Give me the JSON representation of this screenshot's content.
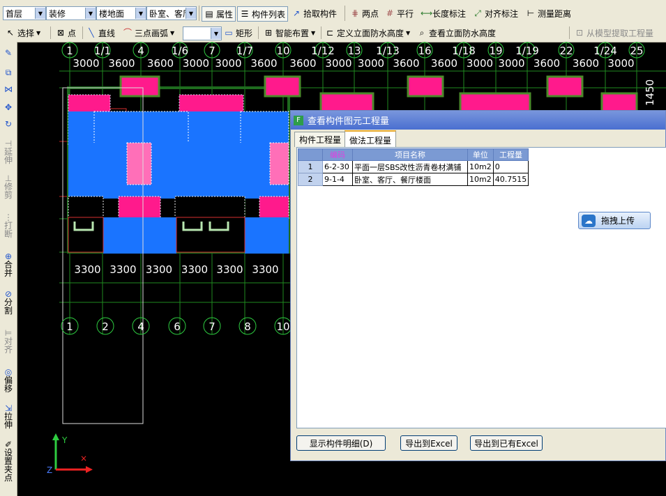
{
  "toolbar1": {
    "floor_combo": "首层",
    "category_combo": "装修",
    "type_combo": "楼地面",
    "name_combo": "卧室、客厅",
    "properties": "属性",
    "component_list": "构件列表",
    "pick_component": "拾取构件",
    "two_points": "两点",
    "parallel": "平行",
    "length_dim": "长度标注",
    "align_dim": "对齐标注",
    "measure_distance": "测量距离"
  },
  "toolbar2": {
    "select": "选择",
    "point": "点",
    "line": "直线",
    "three_point_arc": "三点画弧",
    "blank_combo": "",
    "rectangle": "矩形",
    "smart_layout": "智能布置",
    "define_waterproof": "定义立面防水高度",
    "view_waterproof": "查看立面防水高度",
    "extract_quantity": "从模型提取工程量"
  },
  "left_toolbar": [
    "延伸",
    "修剪",
    "打断",
    "合并",
    "分割",
    "对齐",
    "偏移",
    "拉伸",
    "设置夹点"
  ],
  "canvas": {
    "top_axes": [
      "1",
      "1/1",
      "4",
      "1/6",
      "7",
      "1/7",
      "10",
      "1/12",
      "13",
      "1/13",
      "16",
      "1/18",
      "19",
      "1/19",
      "22",
      "1/24",
      "25"
    ],
    "top_dims": [
      "3000",
      "3600",
      "3600",
      "3000",
      "3000",
      "3600",
      "3600",
      "3000",
      "3000",
      "3600",
      "3600",
      "3000",
      "3000",
      "3600",
      "3600",
      "3000"
    ],
    "bottom_dims": [
      "3300",
      "3300",
      "3300",
      "3300",
      "3300",
      "3300"
    ],
    "bottom_axes": [
      "1",
      "2",
      "4",
      "6",
      "7",
      "8",
      "10"
    ],
    "right_dim": "1450",
    "axis_y": "Y",
    "axis_z": "Z"
  },
  "dialog": {
    "title": "查看构件图元工程量",
    "tabs": [
      "构件工程量",
      "做法工程量"
    ],
    "columns": [
      "编码",
      "项目名称",
      "单位",
      "工程量"
    ],
    "rows": [
      {
        "no": "1",
        "code": "6-2-30",
        "name": "平面一层SBS改性沥青卷材满铺",
        "unit": "10m2",
        "qty": "0"
      },
      {
        "no": "2",
        "code": "9-1-4",
        "name": "卧室、客厅、餐厅楼面",
        "unit": "10m2",
        "qty": "40.7515"
      }
    ],
    "upload": "拖拽上传",
    "buttons": [
      "显示构件明细(D)",
      "导出到Excel",
      "导出到已有Excel"
    ]
  }
}
